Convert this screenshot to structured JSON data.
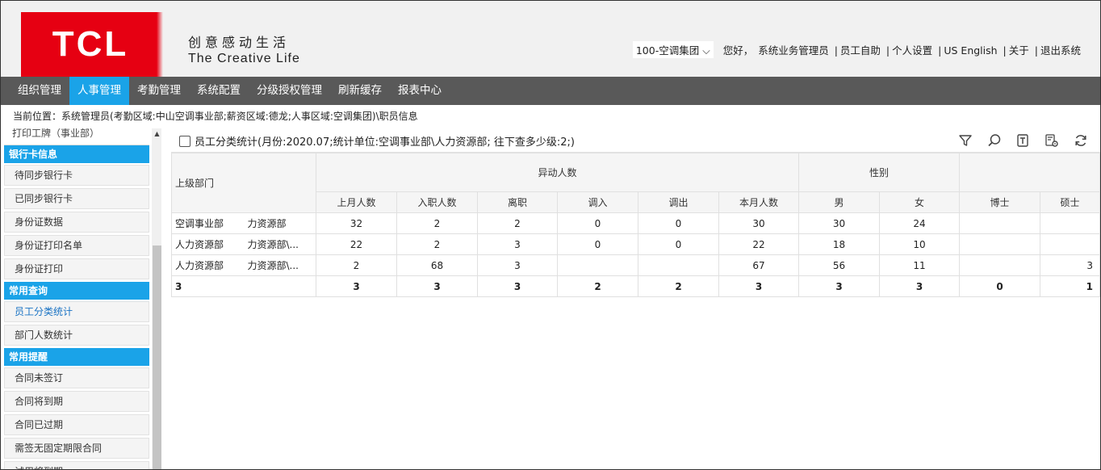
{
  "header": {
    "logo_text": "TCL",
    "slogan_cn": "创意感动生活",
    "slogan_en": "The Creative Life",
    "org_select": "100-空调集团",
    "greeting": "您好，",
    "user_name": "系统业务管理员",
    "links": [
      "员工自助",
      "个人设置",
      "US English",
      "关于",
      "退出系统"
    ]
  },
  "nav": {
    "items": [
      "组织管理",
      "人事管理",
      "考勤管理",
      "系统配置",
      "分级授权管理",
      "刷新缓存",
      "报表中心"
    ],
    "active_index": 1
  },
  "breadcrumb": "当前位置：系统管理员(考勤区域:中山空调事业部;薪资区域:德龙;人事区域:空调集团)\\职员信息",
  "sidebar": {
    "top_partial": "打印工牌（事业部）",
    "groups": [
      {
        "title": "银行卡信息",
        "items": [
          "待同步银行卡",
          "已同步银行卡",
          "身份证数据",
          "身份证打印名单",
          "身份证打印"
        ]
      },
      {
        "title": "常用查询",
        "items": [
          "员工分类统计",
          "部门人数统计"
        ]
      },
      {
        "title": "常用提醒",
        "items": [
          "合同未签订",
          "合同将到期",
          "合同已过期",
          "需签无固定期限合同",
          "试用将到期"
        ]
      }
    ],
    "active_item": "员工分类统计"
  },
  "toolbar": {
    "title": "员工分类统计(月份:2020.07;统计单位:空调事业部\\人力资源部; 往下查多少级:2;)",
    "icons": [
      "filter-icon",
      "search-icon",
      "export-icon",
      "settings-icon",
      "refresh-icon"
    ]
  },
  "table": {
    "parent_header": "上级部门",
    "group_headers": {
      "change": "异动人数",
      "gender": "性别",
      "edu": ""
    },
    "columns": [
      "上月人数",
      "入职人数",
      "离职",
      "调入",
      "调出",
      "本月人数",
      "男",
      "女",
      "博士",
      "硕士"
    ],
    "rows": [
      {
        "dept": "空调事业部",
        "sub": "力资源部",
        "values": [
          "32",
          "2",
          "2",
          "0",
          "0",
          "30",
          "30",
          "24",
          "",
          ""
        ]
      },
      {
        "dept": "人力资源部",
        "sub": "力资源部\\...",
        "values": [
          "22",
          "2",
          "3",
          "0",
          "0",
          "22",
          "18",
          "10",
          "",
          ""
        ]
      },
      {
        "dept": "人力资源部",
        "sub": "力资源部\\...",
        "values": [
          "2",
          "68",
          "3",
          "",
          "",
          "67",
          "56",
          "11",
          "",
          "3"
        ]
      }
    ],
    "total": {
      "dept": "3",
      "values": [
        "3",
        "3",
        "3",
        "2",
        "2",
        "3",
        "3",
        "3",
        "0",
        "1"
      ]
    }
  }
}
